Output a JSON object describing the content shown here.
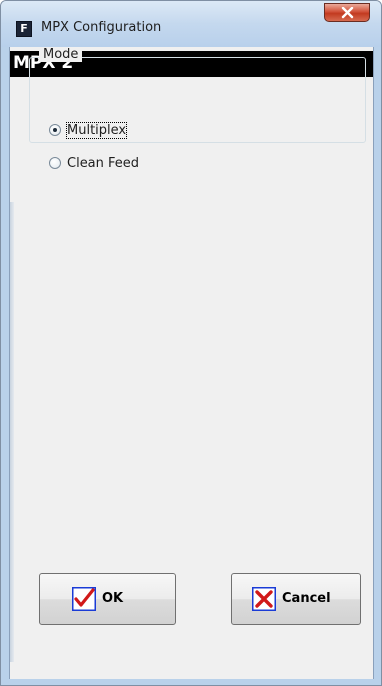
{
  "window": {
    "title": "MPX Configuration",
    "app_icon_letter": "F"
  },
  "header": {
    "title": "MPX 2"
  },
  "mode_group": {
    "label": "Mode",
    "options": [
      {
        "label": "Multiplex",
        "checked": true
      },
      {
        "label": "Clean Feed",
        "checked": false
      }
    ]
  },
  "buttons": {
    "ok_label": "OK",
    "cancel_label": "Cancel"
  },
  "icons": {
    "app": "app-f-icon",
    "close": "close-icon",
    "ok": "checkmark-icon",
    "cancel": "x-cross-icon"
  },
  "colors": {
    "header_bg": "#000000",
    "header_text": "#ffffff",
    "ok_icon": "#1a3bd6",
    "cancel_icon": "#d11919",
    "close_button": "#c9442b"
  }
}
